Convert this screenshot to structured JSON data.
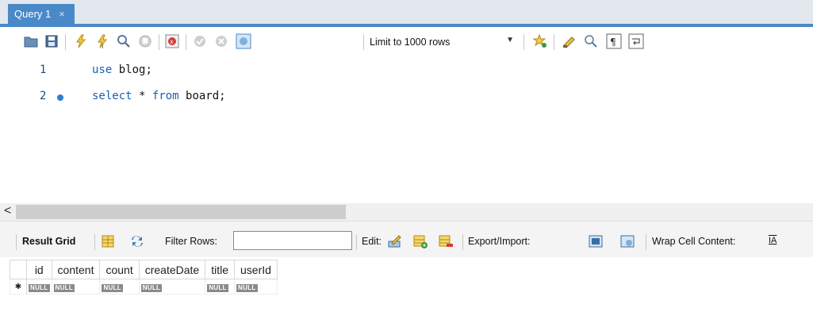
{
  "tab": {
    "title": "Query 1",
    "close": "×"
  },
  "toolbar": {
    "limit": {
      "selected": "Limit to 1000 rows"
    },
    "icons": [
      "open-folder-icon",
      "save-icon",
      "execute-icon",
      "execute-current-icon",
      "explain-icon",
      "stop-icon",
      "toggle-error-icon",
      "commit-icon",
      "rollback-icon",
      "autocommit-icon",
      "add-snippet-icon",
      "beautify-icon",
      "find-icon",
      "invisible-chars-icon",
      "word-wrap-icon"
    ]
  },
  "editor": {
    "lines": [
      {
        "number": "1",
        "keyword": "use",
        "rest": " blog;"
      },
      {
        "number": "2",
        "keyword": "select",
        "middle": " * ",
        "keyword2": "from",
        "rest": " board;"
      }
    ]
  },
  "scroll": {
    "left_arrow": "<"
  },
  "result": {
    "grid_label": "Result Grid",
    "filter_label": "Filter Rows:",
    "filter_value": "",
    "edit_label": "Edit:",
    "export_label": "Export/Import:",
    "wrap_label": "Wrap Cell Content:",
    "wrap_icon_text": "IA"
  },
  "grid": {
    "columns": [
      "id",
      "content",
      "count",
      "createDate",
      "title",
      "userId"
    ],
    "row_marker": "✱",
    "null_text": "NULL"
  },
  "colors": {
    "tab_accent": "#4a89c8",
    "keyword": "#1a5fb4",
    "line_number": "#1c4f7a"
  }
}
